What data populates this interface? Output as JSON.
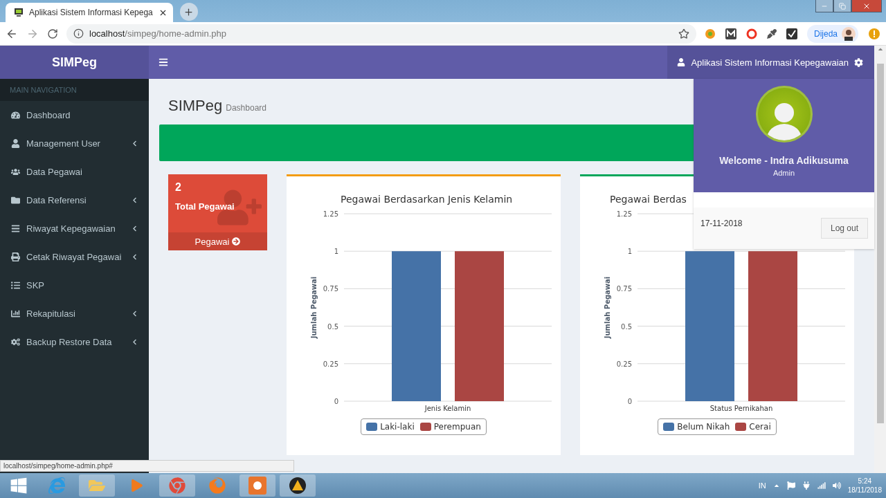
{
  "browser": {
    "tab": {
      "title": "Aplikasi Sistem Informasi Kepega",
      "selected": true
    },
    "url": {
      "host": "localhost",
      "path": "/simpeg/home-admin.php"
    },
    "profile": "Dijeda",
    "status_url": "localhost/simpeg/home-admin.php#"
  },
  "header": {
    "logo": "SIMPeg",
    "user_menu": "Aplikasi Sistem Informasi Kepegawaian"
  },
  "sidebar": {
    "header": "MAIN NAVIGATION",
    "items": [
      {
        "label": "Dashboard",
        "kind": "link"
      },
      {
        "label": "Management User",
        "kind": "treeview"
      },
      {
        "label": "Data Pegawai",
        "kind": "link"
      },
      {
        "label": "Data Referensi",
        "kind": "treeview"
      },
      {
        "label": "Riwayat Kepegawaian",
        "kind": "treeview"
      },
      {
        "label": "Cetak Riwayat Pegawai",
        "kind": "treeview"
      },
      {
        "label": "SKP",
        "kind": "link"
      },
      {
        "label": "Rekapitulasi",
        "kind": "treeview"
      },
      {
        "label": "Backup Restore Data",
        "kind": "treeview"
      }
    ]
  },
  "page": {
    "title": "SIMPeg",
    "subtitle": "Dashboard"
  },
  "stat_box": {
    "count": "2",
    "label": "Total Pegawai",
    "link": "Pegawai"
  },
  "charts": [
    {
      "color": "#f39c12",
      "chart_data": {
        "type": "bar",
        "grid": true,
        "legend": "bottom",
        "title": "Pegawai Berdasarkan Jenis Kelamin",
        "ylabel": "Jumlah Pegawai",
        "categories": [
          "Jenis Kelamin"
        ],
        "ylim": [
          0,
          1.25
        ],
        "yticks": [
          0,
          0.25,
          0.5,
          0.75,
          1,
          1.25
        ],
        "series": [
          {
            "name": "Laki-laki",
            "color": "#4572a7",
            "values": [
              1
            ]
          },
          {
            "name": "Perempuan",
            "color": "#aa4643",
            "values": [
              1
            ]
          }
        ]
      }
    },
    {
      "color": "#00a65a",
      "chart_data": {
        "type": "bar",
        "grid": true,
        "legend": "bottom",
        "title": "Pegawai Berdas",
        "ylabel": "Jumlah Pegawai",
        "categories": [
          "Status Pernikahan"
        ],
        "ylim": [
          0,
          1.25
        ],
        "yticks": [
          0,
          0.25,
          0.5,
          0.75,
          1,
          1.25
        ],
        "series": [
          {
            "name": "Belum Nikah",
            "color": "#4572a7",
            "values": [
              1
            ]
          },
          {
            "name": "Cerai",
            "color": "#aa4643",
            "values": [
              1
            ]
          }
        ]
      }
    }
  ],
  "user_dropdown": {
    "name": "Welcome - Indra Adikusuma",
    "role": "Admin",
    "date": "17-11-2018",
    "logout": "Log out"
  },
  "taskbar": {
    "language": "IN",
    "time": "5:24",
    "date": "18/11/2018"
  }
}
